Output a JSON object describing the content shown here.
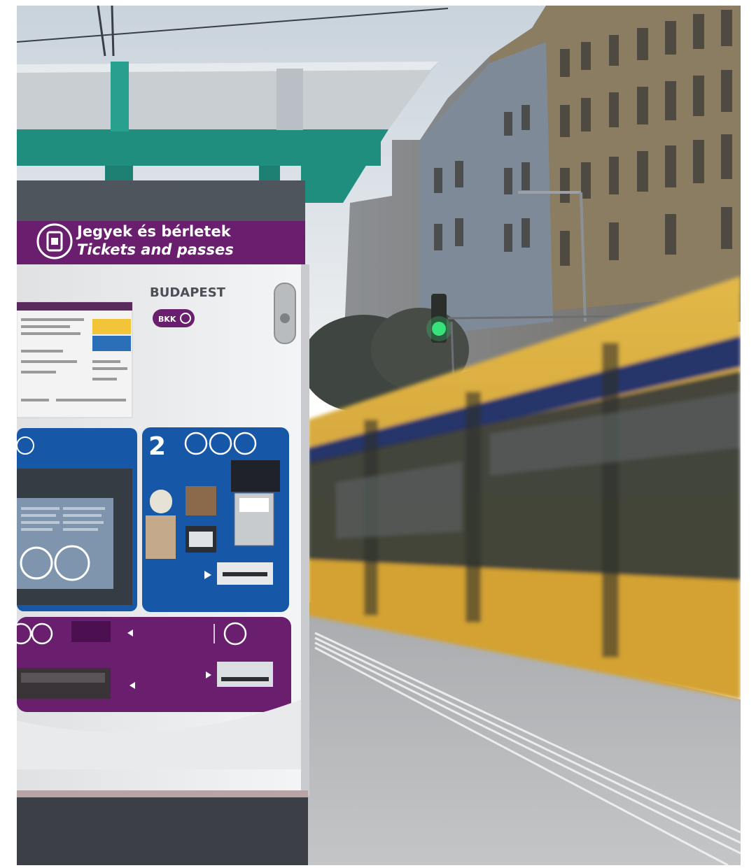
{
  "scene": {
    "kind": "photo",
    "subject": "ticket vending machine at tram stop with moving yellow tram"
  },
  "machine": {
    "header_line1": "Jegyek és bérletek",
    "header_line2": "Tickets and passes",
    "brand": "BUDAPEST",
    "bkk_badge": "BKK",
    "step_number": "2"
  },
  "colors": {
    "purple": "#6a1f6e",
    "blue": "#1757a8",
    "teal": "#1f8e7e",
    "tram_yellow": "#d8a93a",
    "sky": "#dfe4ea",
    "pavement": "#b7b7b7"
  }
}
